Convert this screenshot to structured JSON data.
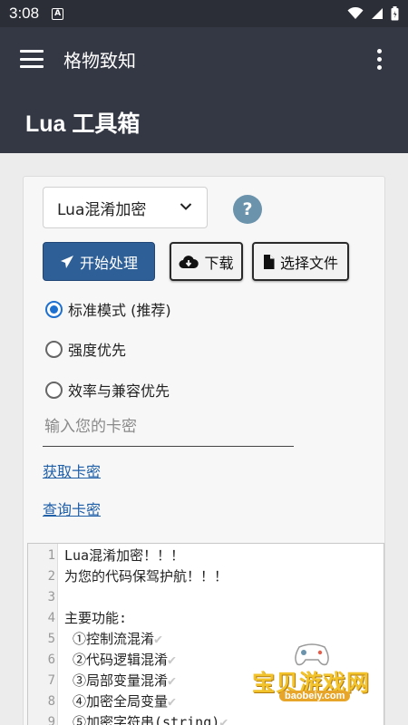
{
  "status": {
    "time": "3:08",
    "notif_icon": "A"
  },
  "appbar": {
    "title": "格物致知"
  },
  "page": {
    "title": "Lua 工具箱"
  },
  "mode_select": {
    "value": "Lua混淆加密"
  },
  "help": {
    "label": "?"
  },
  "buttons": {
    "start": "开始处理",
    "download": "下载",
    "choose_file": "选择文件"
  },
  "options": [
    {
      "label": "标准模式 (推荐)",
      "selected": true
    },
    {
      "label": "强度优先",
      "selected": false
    },
    {
      "label": "效率与兼容优先",
      "selected": false
    }
  ],
  "card_key": {
    "placeholder": "输入您的卡密",
    "value": ""
  },
  "links": {
    "get_key": "获取卡密",
    "query_key": "查询卡密"
  },
  "editor": {
    "lines": [
      {
        "n": "1",
        "text": "Lua混淆加密！！！",
        "check": ""
      },
      {
        "n": "2",
        "text": "为您的代码保驾护航！！！",
        "check": ""
      },
      {
        "n": "3",
        "text": "",
        "check": ""
      },
      {
        "n": "4",
        "text": "主要功能:",
        "check": ""
      },
      {
        "n": "5",
        "text": " ①控制流混淆",
        "check": "✔"
      },
      {
        "n": "6",
        "text": " ②代码逻辑混淆",
        "check": "✔"
      },
      {
        "n": "7",
        "text": " ③局部变量混淆",
        "check": "✔"
      },
      {
        "n": "8",
        "text": " ④加密全局变量",
        "check": "✔"
      },
      {
        "n": "9",
        "text": " ⑤加密字符串(string)",
        "check": "✔"
      }
    ]
  },
  "watermark": {
    "text": "宝贝游戏网",
    "url": "baobeiy.com"
  },
  "colors": {
    "appbar": "#343845",
    "primary": "#2f5f97",
    "link": "#1f5fa8",
    "radio": "#1d6fd0"
  }
}
